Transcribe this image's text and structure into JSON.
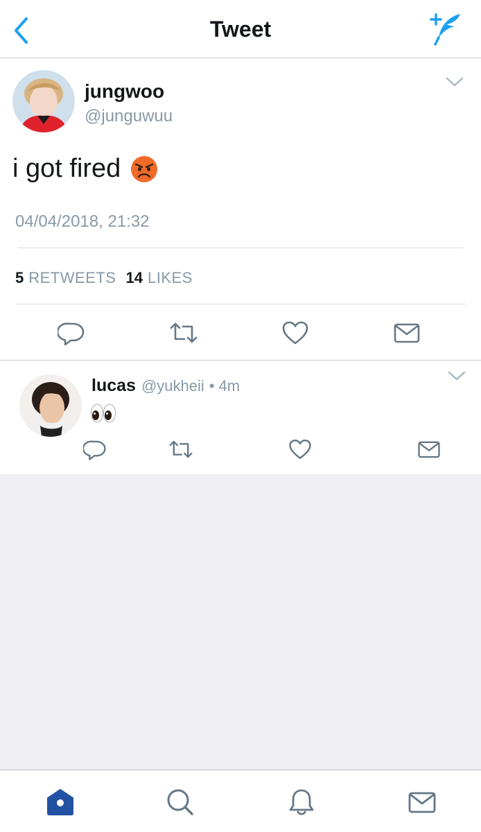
{
  "colors": {
    "accent": "#1da1f2",
    "secondary_text": "#8899a6",
    "primary_text": "#14171a",
    "icon_gray": "#657786",
    "home_active": "#2452a3",
    "angry_face": "#f06a2a",
    "background_gray": "#efeff4"
  },
  "nav": {
    "title": "Tweet",
    "back_icon": "chevron-left-icon",
    "compose_icon": "compose-tweet-icon"
  },
  "main_tweet": {
    "display_name": "jungwoo",
    "handle": "@junguwuu",
    "text": "i got fired",
    "emoji": "angry-face-emoji",
    "timestamp": "04/04/2018, 21:32",
    "retweets": {
      "count": "5",
      "label": "RETWEETS"
    },
    "likes": {
      "count": "14",
      "label": "LIKES"
    },
    "actions": [
      "reply-icon",
      "retweet-icon",
      "like-icon",
      "direct-message-icon"
    ]
  },
  "reply": {
    "display_name": "lucas",
    "handle": "@yukheii",
    "separator": "•",
    "time": "4m",
    "emoji": "eyes-emoji",
    "actions": [
      "reply-icon",
      "retweet-icon",
      "like-icon",
      "direct-message-icon"
    ]
  },
  "tab_bar": {
    "tabs": [
      {
        "name": "home",
        "icon": "home-icon",
        "active": true
      },
      {
        "name": "search",
        "icon": "search-icon",
        "active": false
      },
      {
        "name": "notifications",
        "icon": "bell-icon",
        "active": false
      },
      {
        "name": "messages",
        "icon": "mail-icon",
        "active": false
      }
    ]
  }
}
